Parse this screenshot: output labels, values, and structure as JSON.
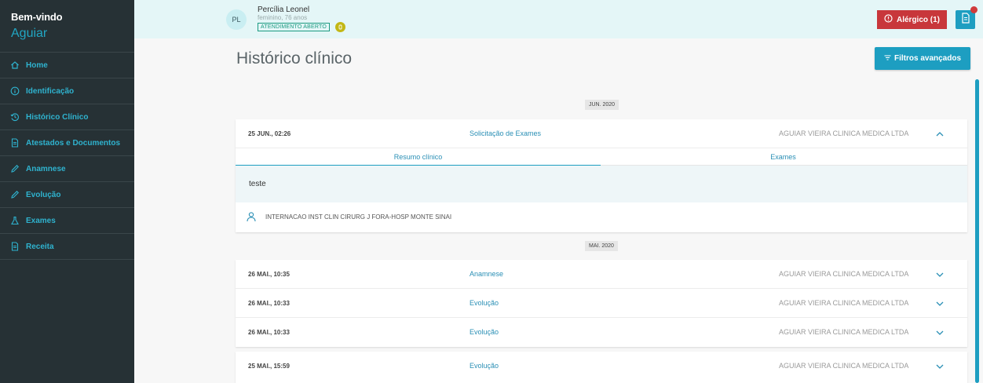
{
  "sidebar": {
    "welcome": "Bem-vindo",
    "user": "Aguiar",
    "items": [
      {
        "label": "Home",
        "icon": "home-icon"
      },
      {
        "label": "Identificação",
        "icon": "info-icon"
      },
      {
        "label": "Histórico Clínico",
        "icon": "history-icon"
      },
      {
        "label": "Atestados e Documentos",
        "icon": "document-icon"
      },
      {
        "label": "Anamnese",
        "icon": "pencil-icon"
      },
      {
        "label": "Evolução",
        "icon": "pencil-icon"
      },
      {
        "label": "Exames",
        "icon": "flask-icon"
      },
      {
        "label": "Receita",
        "icon": "document-icon"
      }
    ]
  },
  "header": {
    "avatar_initials": "PL",
    "patient_name": "Percília Leonel",
    "patient_info": "feminino, 76 anos",
    "status_badge": "ATENDIMENTO ABERTO",
    "allergy_label": "Alérgico (1)"
  },
  "main": {
    "title": "Histórico clínico",
    "filters_label": "Filtros avançados",
    "month1": "JUN. 2020",
    "month2": "MAI. 2020",
    "expanded": {
      "date": "25 JUN., 02:26",
      "type": "Solicitação de Exames",
      "clinic": "AGUIAR VIEIRA CLINICA MEDICA LTDA",
      "tab1": "Resumo clínico",
      "tab2": "Exames",
      "summary": "teste",
      "internacao": "INTERNACAO INST CLIN CIRURG J FORA-HOSP MONTE SINAI"
    },
    "may_entries": [
      {
        "date": "26 MAI., 10:35",
        "type": "Anamnese",
        "clinic": "AGUIAR VIEIRA CLINICA MEDICA LTDA"
      },
      {
        "date": "26 MAI., 10:33",
        "type": "Evolução",
        "clinic": "AGUIAR VIEIRA CLINICA MEDICA LTDA"
      },
      {
        "date": "26 MAI., 10:33",
        "type": "Evolução",
        "clinic": "AGUIAR VIEIRA CLINICA MEDICA LTDA"
      }
    ],
    "last_entry": {
      "date": "25 MAI., 15:59",
      "type": "Evolução",
      "clinic": "AGUIAR VIEIRA CLINICA MEDICA LTDA"
    }
  },
  "colors": {
    "accent": "#1d9ec1",
    "sidebar_bg": "#263135",
    "allergy": "#c8373b",
    "header_bg": "#e4f6f7"
  }
}
